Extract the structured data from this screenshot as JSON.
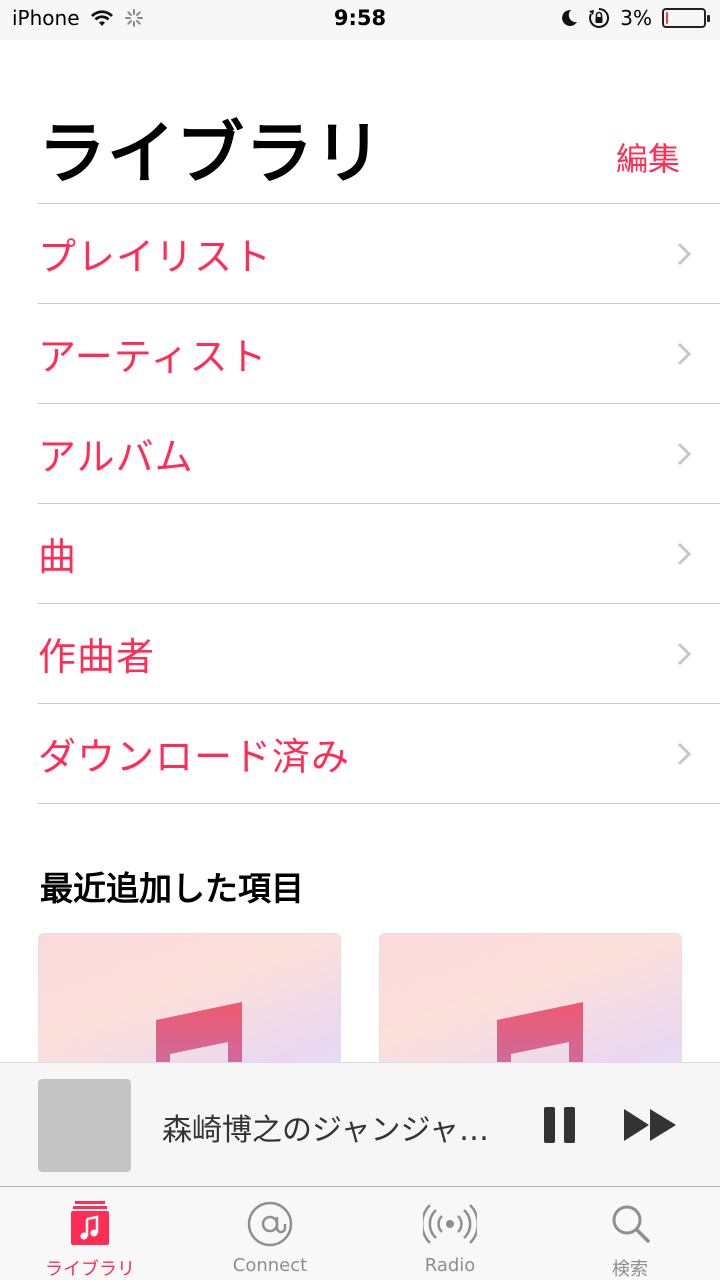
{
  "status_bar": {
    "carrier": "iPhone",
    "time": "9:58",
    "battery_percent": "3%",
    "battery_level": 0.03,
    "icons": [
      "wifi-icon",
      "activity-spinner-icon",
      "moon-icon",
      "rotation-lock-icon",
      "battery-icon"
    ]
  },
  "header": {
    "title": "ライブラリ",
    "edit_label": "編集"
  },
  "library_items": [
    {
      "label": "プレイリスト"
    },
    {
      "label": "アーティスト"
    },
    {
      "label": "アルバム"
    },
    {
      "label": "曲"
    },
    {
      "label": "作曲者"
    },
    {
      "label": "ダウンロード済み"
    }
  ],
  "recent": {
    "title": "最近追加した項目"
  },
  "mini_player": {
    "track_title": "森崎博之のジャンジャ…"
  },
  "tabs": [
    {
      "label": "ライブラリ",
      "icon": "music-note-icon",
      "active": true
    },
    {
      "label": "Connect",
      "icon": "at-sign-icon",
      "active": false
    },
    {
      "label": "Radio",
      "icon": "radio-broadcast-icon",
      "active": false
    },
    {
      "label": "検索",
      "icon": "search-icon",
      "active": false
    }
  ],
  "colors": {
    "accent": "#ff2d55",
    "separator": "#c8c7cc",
    "inactive_tab": "#8e8e93"
  }
}
